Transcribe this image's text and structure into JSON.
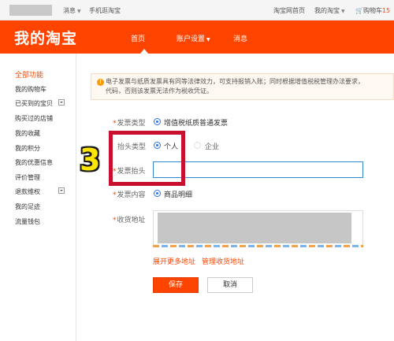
{
  "topbar": {
    "messages_label": "消息",
    "mobile_label": "手机逛淘宝",
    "home_label": "淘宝网首页",
    "mytaobao_label": "我的淘宝",
    "cart_label": "购物车",
    "cart_count": "15"
  },
  "header": {
    "logo": "我的淘宝",
    "nav_home": "首页",
    "nav_account": "账户设置",
    "nav_messages": "消息",
    "brand_color": "#ff4400"
  },
  "sidebar": {
    "title": "全部功能",
    "items": [
      "我的购物车",
      "已买到的宝贝",
      "购买过的店铺",
      "我的收藏",
      "我的积分",
      "我的优惠信息",
      "评价管理",
      "退款维权",
      "我的足迹",
      "流量钱包"
    ]
  },
  "notice": {
    "text_line1": "电子发票与纸质发票具有同等法律效力，可支持报销入账；同时根据增值税税管理办法要求，",
    "text_line2": "代码，否则该发票无法作为税收凭证。"
  },
  "form": {
    "invoice_type_label": "发票类型",
    "invoice_type_value": "增值税纸质普通发票",
    "header_type_label": "抬头类型",
    "header_type_personal": "个人",
    "header_type_company": "企业",
    "invoice_header_label": "发票抬头",
    "invoice_header_value": "",
    "content_label": "发票内容",
    "content_value": "商品明细",
    "address_label": "收货地址",
    "expand_link": "展开更多地址",
    "manage_link": "管理收货地址",
    "save_label": "保存",
    "cancel_label": "取消"
  },
  "annotation": {
    "step_number": "3"
  }
}
